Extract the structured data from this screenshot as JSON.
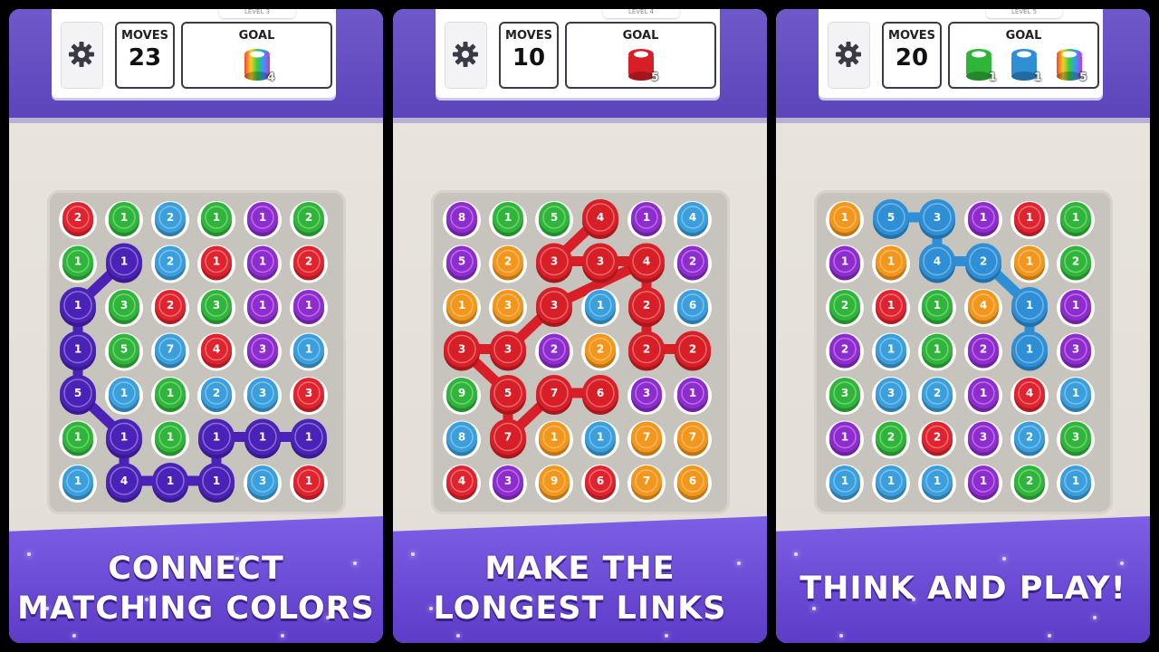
{
  "panels": [
    {
      "level": "LEVEL 3",
      "moves_label": "MOVES",
      "moves": "23",
      "goal_label": "GOAL",
      "goals": [
        {
          "color": "rainbow",
          "count": "4"
        }
      ],
      "caption": [
        "CONNECT",
        "MATCHING COLORS"
      ],
      "grid": [
        [
          [
            "r",
            "2"
          ],
          [
            "g",
            "1"
          ],
          [
            "b",
            "2"
          ],
          [
            "g",
            "1"
          ],
          [
            "p",
            "1"
          ],
          [
            "g",
            "2"
          ]
        ],
        [
          [
            "g",
            "1"
          ],
          [
            "v",
            "1"
          ],
          [
            "b",
            "2"
          ],
          [
            "r",
            "1"
          ],
          [
            "p",
            "1"
          ],
          [
            "r",
            "2"
          ]
        ],
        [
          [
            "v",
            "1"
          ],
          [
            "g",
            "3"
          ],
          [
            "r",
            "2"
          ],
          [
            "g",
            "3"
          ],
          [
            "p",
            "1"
          ],
          [
            "p",
            "1"
          ]
        ],
        [
          [
            "v",
            "1"
          ],
          [
            "g",
            "5"
          ],
          [
            "b",
            "7"
          ],
          [
            "r",
            "4"
          ],
          [
            "p",
            "3"
          ],
          [
            "b",
            "1"
          ]
        ],
        [
          [
            "v",
            "5"
          ],
          [
            "b",
            "1"
          ],
          [
            "g",
            "1"
          ],
          [
            "b",
            "2"
          ],
          [
            "b",
            "3"
          ],
          [
            "r",
            "3"
          ]
        ],
        [
          [
            "g",
            "1"
          ],
          [
            "v",
            "1"
          ],
          [
            "g",
            "1"
          ],
          [
            "v",
            "1"
          ],
          [
            "v",
            "1"
          ],
          [
            "v",
            "1"
          ]
        ],
        [
          [
            "b",
            "1"
          ],
          [
            "v",
            "4"
          ],
          [
            "v",
            "1"
          ],
          [
            "v",
            "1"
          ],
          [
            "b",
            "3"
          ],
          [
            "r",
            "1"
          ]
        ]
      ],
      "path": [
        [
          1,
          1
        ],
        [
          2,
          0
        ],
        [
          3,
          0
        ],
        [
          4,
          0
        ],
        [
          5,
          1
        ],
        [
          6,
          1
        ],
        [
          6,
          2
        ],
        [
          6,
          3
        ],
        [
          5,
          3
        ],
        [
          5,
          4
        ],
        [
          5,
          5
        ]
      ],
      "path_color": "v"
    },
    {
      "level": "LEVEL 4",
      "moves_label": "MOVES",
      "moves": "10",
      "goal_label": "GOAL",
      "goals": [
        {
          "color": "red",
          "count": "5"
        }
      ],
      "caption": [
        "MAKE THE",
        "LONGEST LINKS"
      ],
      "grid": [
        [
          [
            "p",
            "8"
          ],
          [
            "g",
            "1"
          ],
          [
            "g",
            "5"
          ],
          [
            "R",
            "4"
          ],
          [
            "p",
            "1"
          ],
          [
            "b",
            "4"
          ]
        ],
        [
          [
            "p",
            "5"
          ],
          [
            "o",
            "2"
          ],
          [
            "R",
            "3"
          ],
          [
            "R",
            "3"
          ],
          [
            "R",
            "4"
          ],
          [
            "p",
            "2"
          ]
        ],
        [
          [
            "o",
            "1"
          ],
          [
            "o",
            "3"
          ],
          [
            "R",
            "3"
          ],
          [
            "b",
            "1"
          ],
          [
            "R",
            "2"
          ],
          [
            "b",
            "6"
          ]
        ],
        [
          [
            "R",
            "3"
          ],
          [
            "R",
            "3"
          ],
          [
            "p",
            "2"
          ],
          [
            "o",
            "2"
          ],
          [
            "R",
            "2"
          ],
          [
            "R",
            "2"
          ]
        ],
        [
          [
            "g",
            "9"
          ],
          [
            "R",
            "5"
          ],
          [
            "R",
            "7"
          ],
          [
            "R",
            "6"
          ],
          [
            "p",
            "3"
          ],
          [
            "p",
            "1"
          ]
        ],
        [
          [
            "b",
            "8"
          ],
          [
            "R",
            "7"
          ],
          [
            "o",
            "1"
          ],
          [
            "b",
            "1"
          ],
          [
            "o",
            "7"
          ],
          [
            "o",
            "7"
          ]
        ],
        [
          [
            "r",
            "4"
          ],
          [
            "p",
            "3"
          ],
          [
            "o",
            "9"
          ],
          [
            "r",
            "6"
          ],
          [
            "o",
            "7"
          ],
          [
            "o",
            "6"
          ]
        ]
      ],
      "path": [
        [
          0,
          3
        ],
        [
          1,
          2
        ],
        [
          1,
          3
        ],
        [
          1,
          4
        ],
        [
          2,
          4
        ],
        [
          3,
          4
        ],
        [
          3,
          5
        ],
        [
          3,
          4
        ],
        [
          2,
          4
        ],
        [
          1,
          4
        ],
        [
          2,
          2
        ],
        [
          3,
          1
        ],
        [
          3,
          0
        ],
        [
          4,
          1
        ],
        [
          5,
          1
        ],
        [
          4,
          2
        ],
        [
          4,
          3
        ]
      ],
      "path_color": "R"
    },
    {
      "level": "LEVEL 5",
      "moves_label": "MOVES",
      "moves": "20",
      "goal_label": "GOAL",
      "goals": [
        {
          "color": "green",
          "count": "1"
        },
        {
          "color": "blue",
          "count": "1"
        },
        {
          "color": "rainbow",
          "count": "5"
        }
      ],
      "caption": [
        "THINK AND PLAY!"
      ],
      "grid": [
        [
          [
            "o",
            "1"
          ],
          [
            "B",
            "5"
          ],
          [
            "B",
            "3"
          ],
          [
            "p",
            "1"
          ],
          [
            "r",
            "1"
          ],
          [
            "g",
            "1"
          ]
        ],
        [
          [
            "p",
            "1"
          ],
          [
            "o",
            "1"
          ],
          [
            "B",
            "4"
          ],
          [
            "B",
            "2"
          ],
          [
            "o",
            "1"
          ],
          [
            "g",
            "2"
          ]
        ],
        [
          [
            "g",
            "2"
          ],
          [
            "r",
            "1"
          ],
          [
            "g",
            "1"
          ],
          [
            "o",
            "4"
          ],
          [
            "B",
            "1"
          ],
          [
            "p",
            "1"
          ]
        ],
        [
          [
            "p",
            "2"
          ],
          [
            "b",
            "1"
          ],
          [
            "g",
            "1"
          ],
          [
            "p",
            "2"
          ],
          [
            "B",
            "1"
          ],
          [
            "p",
            "3"
          ]
        ],
        [
          [
            "g",
            "3"
          ],
          [
            "b",
            "3"
          ],
          [
            "b",
            "2"
          ],
          [
            "p",
            "1"
          ],
          [
            "r",
            "4"
          ],
          [
            "b",
            "1"
          ]
        ],
        [
          [
            "p",
            "1"
          ],
          [
            "g",
            "2"
          ],
          [
            "r",
            "2"
          ],
          [
            "p",
            "3"
          ],
          [
            "b",
            "2"
          ],
          [
            "g",
            "3"
          ]
        ],
        [
          [
            "b",
            "1"
          ],
          [
            "b",
            "1"
          ],
          [
            "b",
            "1"
          ],
          [
            "p",
            "1"
          ],
          [
            "g",
            "2"
          ],
          [
            "b",
            "1"
          ]
        ]
      ],
      "path": [
        [
          0,
          1
        ],
        [
          0,
          2
        ],
        [
          1,
          2
        ],
        [
          1,
          3
        ],
        [
          2,
          4
        ],
        [
          3,
          4
        ]
      ],
      "path_color": "B"
    }
  ],
  "colors": {
    "r": "#e0242f",
    "R": "#d81e26",
    "g": "#2fb63a",
    "b": "#3a9fdc",
    "B": "#2e8fd6",
    "p": "#8e2ccf",
    "v": "#4a22b8",
    "o": "#f2961c"
  }
}
